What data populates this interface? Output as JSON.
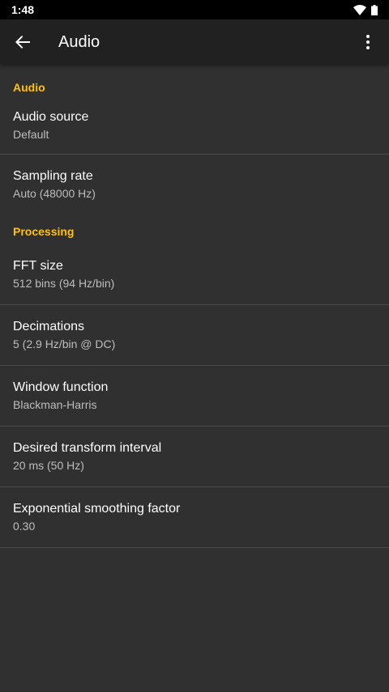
{
  "status_bar": {
    "time": "1:48",
    "icons": [
      "wifi-icon",
      "battery-icon"
    ]
  },
  "app_bar": {
    "title": "Audio",
    "back_icon": "arrow-back-icon",
    "overflow_icon": "more-vert-icon"
  },
  "colors": {
    "accent": "#ffc107",
    "background": "#303030",
    "app_bar": "#212121"
  },
  "sections": [
    {
      "header": "Audio",
      "items": [
        {
          "title": "Audio source",
          "summary": "Default"
        },
        {
          "title": "Sampling rate",
          "summary": "Auto (48000 Hz)"
        }
      ]
    },
    {
      "header": "Processing",
      "items": [
        {
          "title": "FFT size",
          "summary": "512 bins (94 Hz/bin)"
        },
        {
          "title": "Decimations",
          "summary": "5 (2.9 Hz/bin @ DC)"
        },
        {
          "title": "Window function",
          "summary": "Blackman-Harris"
        },
        {
          "title": "Desired transform interval",
          "summary": "20 ms (50 Hz)"
        },
        {
          "title": "Exponential smoothing factor",
          "summary": "0.30"
        }
      ]
    }
  ]
}
